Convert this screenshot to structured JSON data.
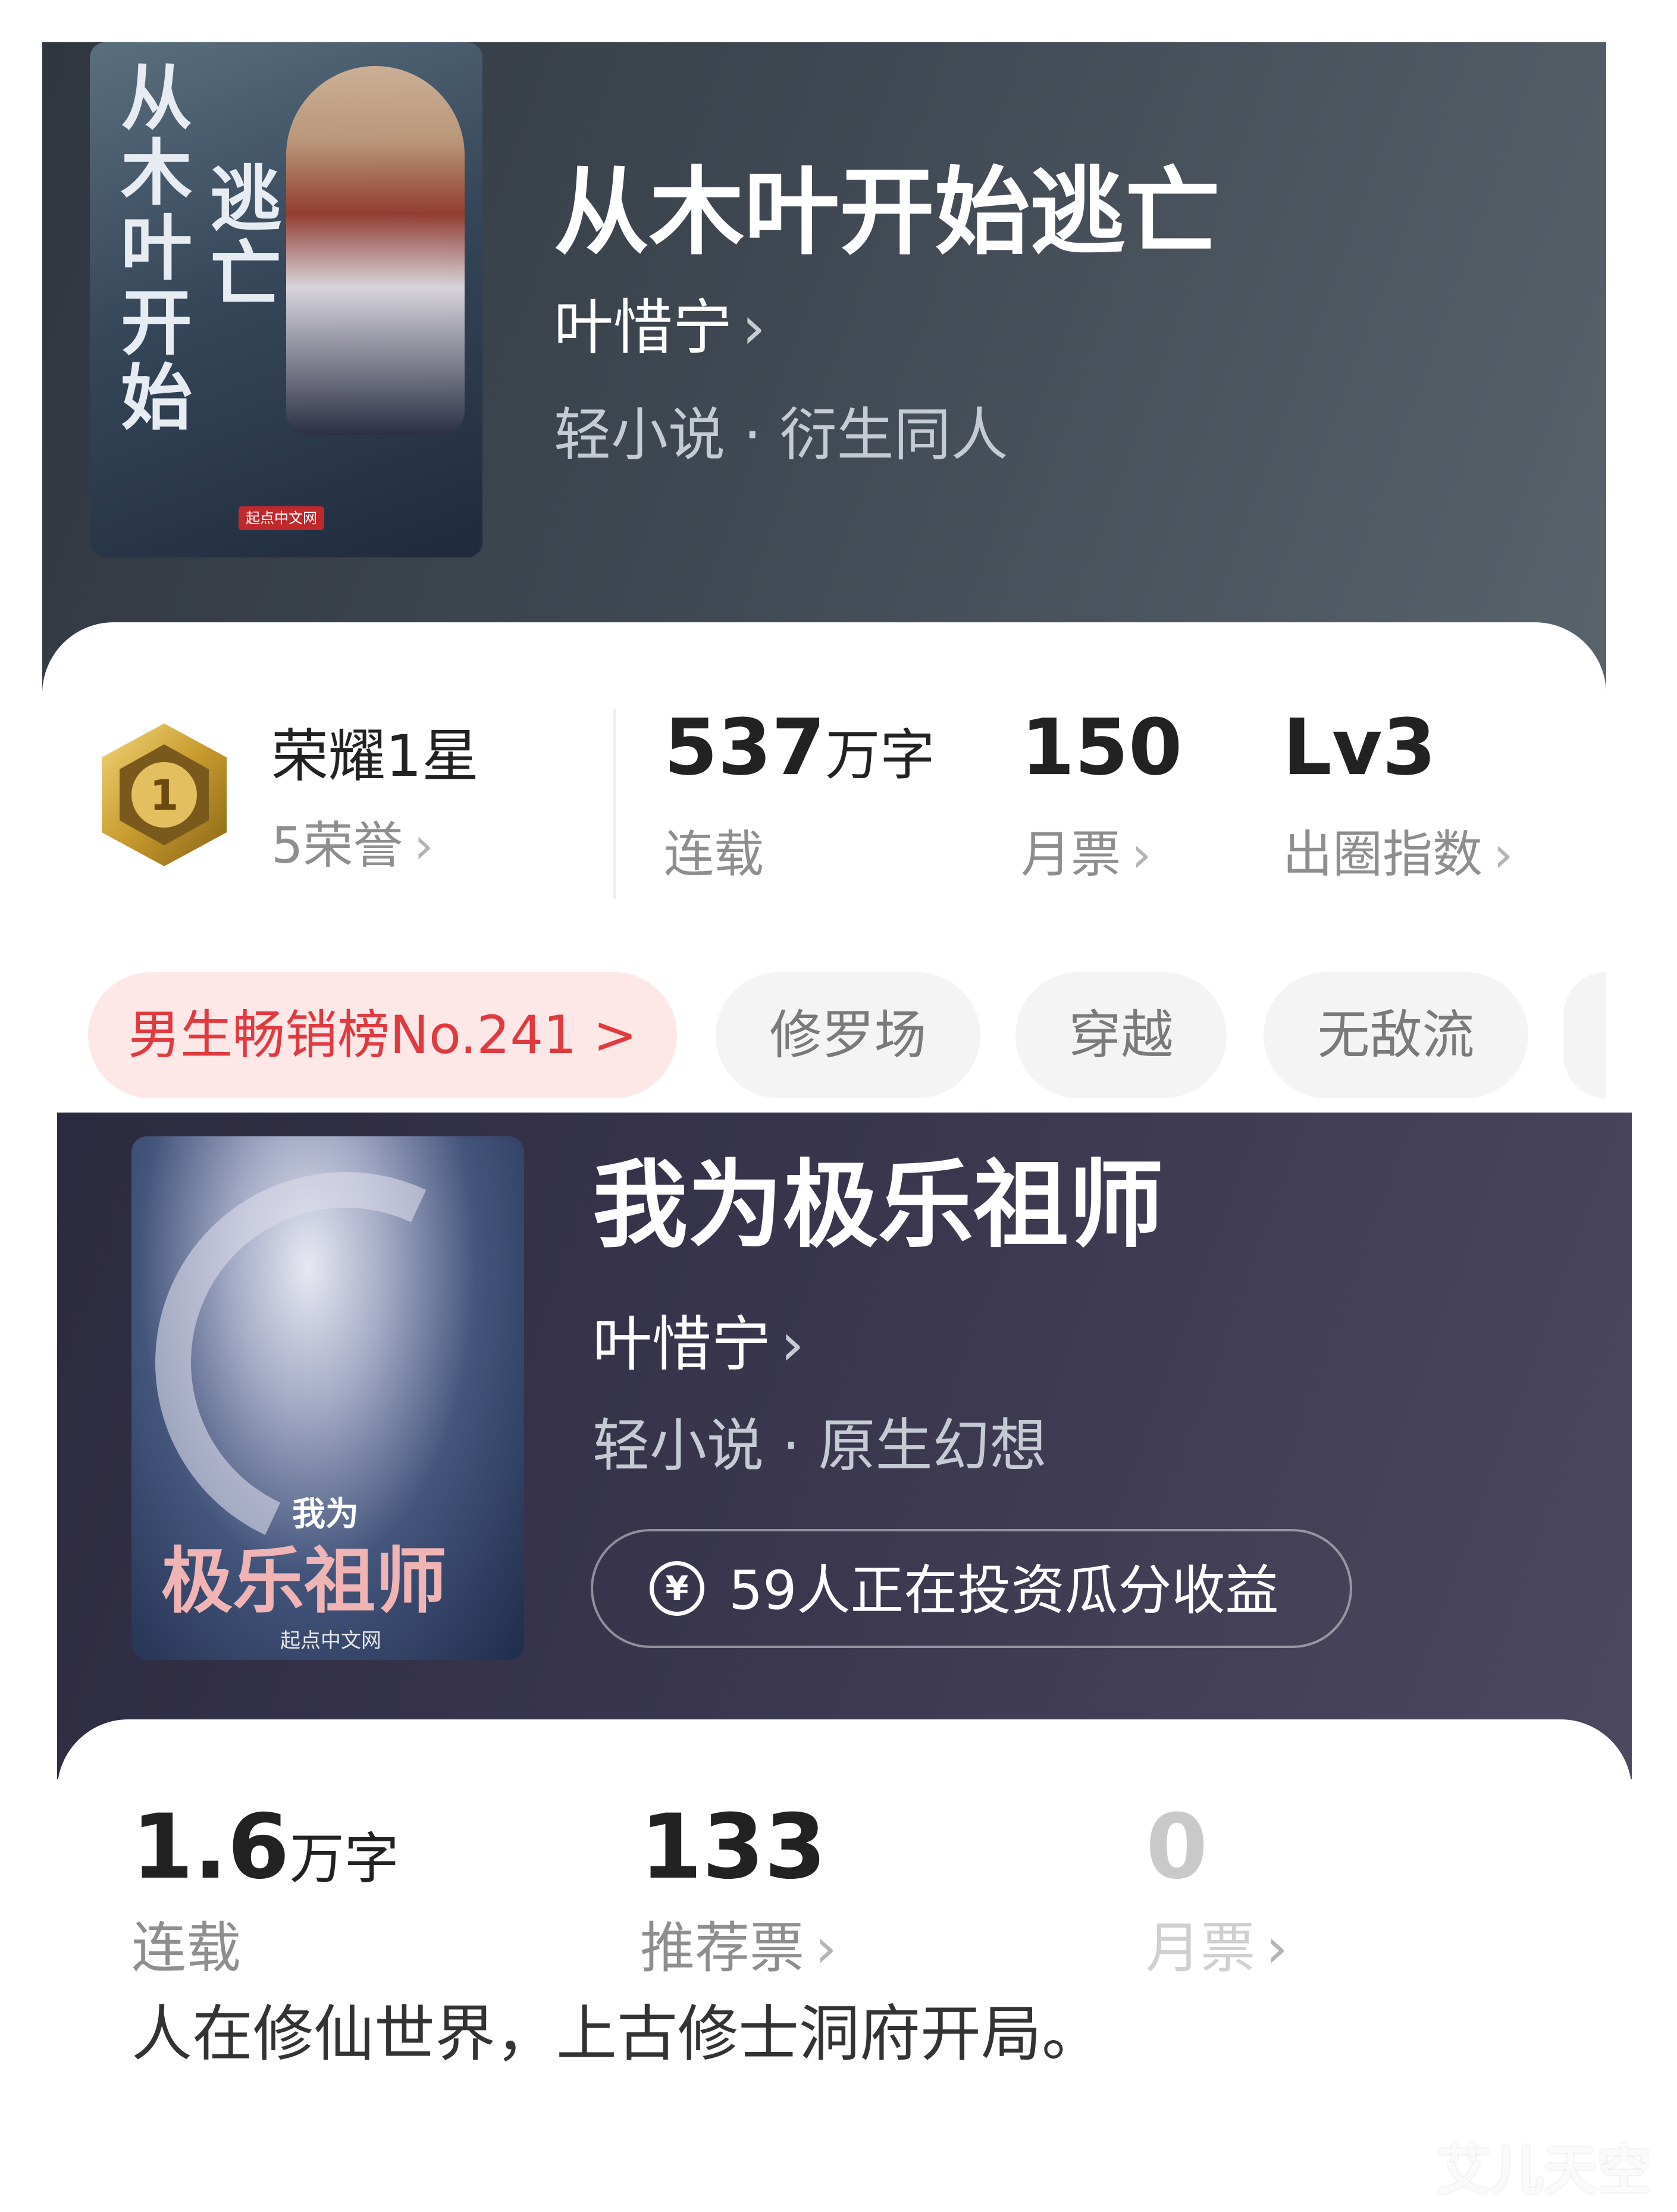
{
  "book1": {
    "title": "从木叶开始逃亡",
    "author": "叶惜宁",
    "genre": "轻小说 · 衍生同人",
    "cover": {
      "title_a": "从木叶开始",
      "title_b": "逃亡",
      "logo": "起点中文网"
    },
    "honor": {
      "badge_number": "1",
      "title": "荣耀1星",
      "sub": "5荣誉"
    },
    "stats": [
      {
        "value": "537",
        "unit": "万字",
        "label": "连载"
      },
      {
        "value": "150",
        "unit": "",
        "label": "月票"
      },
      {
        "value": "Lv3",
        "unit": "",
        "label": "出圈指数"
      }
    ],
    "tags": [
      "男生畅销榜No.241 >",
      "修罗场",
      "穿越",
      "无敌流"
    ]
  },
  "book2": {
    "title": "我为极乐祖师",
    "author": "叶惜宁",
    "genre": "轻小说 · 原生幻想",
    "cover": {
      "title_a": "我为",
      "title_b": "极乐祖师",
      "logo": "起点中文网"
    },
    "invest": {
      "icon": "¥",
      "text": "59人正在投资瓜分收益"
    },
    "stats": [
      {
        "value": "1.6",
        "unit": "万字",
        "label": "连载"
      },
      {
        "value": "133",
        "unit": "",
        "label": "推荐票"
      },
      {
        "value": "0",
        "unit": "",
        "label": "月票"
      }
    ],
    "description": "人在修仙世界，上古修士洞府开局。"
  },
  "icons": {
    "chevron": "›"
  },
  "watermark": "艾儿天空"
}
